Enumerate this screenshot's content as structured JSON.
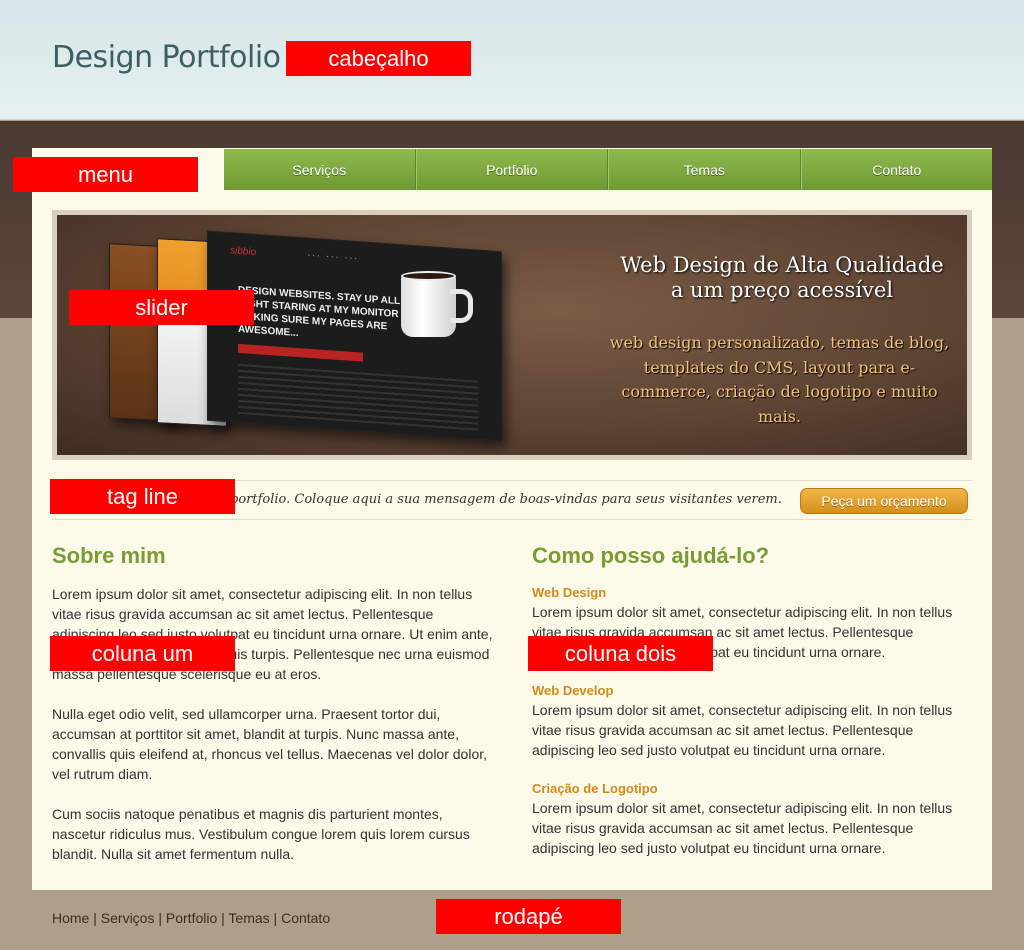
{
  "header": {
    "title": "Design Portfolio"
  },
  "annotations": {
    "header": "cabeçalho",
    "menu": "menu",
    "slider": "slider",
    "tagline": "tag line",
    "column_one": "coluna um",
    "column_two": "coluna dois",
    "footer": "rodapé"
  },
  "nav": {
    "items": [
      "Serviços",
      "Portfolio",
      "Temas",
      "Contato"
    ]
  },
  "slider": {
    "title_line1": "Web Design de Alta Qualidade",
    "title_line2": "a um preço acessível",
    "text": "web design personalizado, temas de blog, templates do CMS, layout para e-commerce, criação de logotipo e muito mais.",
    "mock_heading": "DESIGN WEBSITES. STAY UP ALL NIGHT STARING AT MY MONITOR MAKING SURE MY PAGES ARE AWESOME..."
  },
  "tagline": {
    "text": "portfolio. Coloque aqui a sua mensagem de boas-vindas para seus visitantes verem.",
    "button": "Peça um orçamento"
  },
  "column_one": {
    "heading": "Sobre mim",
    "paragraphs": [
      "Lorem ipsum dolor sit amet, consectetur adipiscing elit. In non tellus vitae risus gravida accumsan ac sit amet lectus. Pellentesque adipiscing leo sed justo volutpat eu tincidunt urna ornare. Ut enim ante, condimentum quis sodales quis turpis. Pellentesque nec urna euismod massa pellentesque scelerisque eu at eros.",
      "Nulla eget odio velit, sed ullamcorper urna. Praesent tortor dui, accumsan at porttitor sit amet, blandit at turpis. Nunc massa ante, convallis quis eleifend at, rhoncus vel tellus. Maecenas vel dolor dolor, vel rutrum diam.",
      "Cum sociis natoque penatibus et magnis dis parturient montes, nascetur ridiculus mus. Vestibulum congue lorem quis lorem cursus blandit. Nulla sit amet fermentum nulla."
    ]
  },
  "column_two": {
    "heading": "Como posso ajudá-lo?",
    "services": [
      {
        "title": "Web Design",
        "text": "Lorem ipsum dolor sit amet, consectetur adipiscing elit. In non tellus vitae risus gravida accumsan ac sit amet lectus. Pellentesque adipiscing leo sed justo volutpat eu tincidunt urna ornare."
      },
      {
        "title": "Web Develop",
        "text": "Lorem ipsum dolor sit amet, consectetur adipiscing elit. In non tellus vitae risus gravida accumsan ac sit amet lectus. Pellentesque adipiscing leo sed justo volutpat eu tincidunt urna ornare."
      },
      {
        "title": "Criação de Logotipo",
        "text": "Lorem ipsum dolor sit amet, consectetur adipiscing elit. In non tellus vitae risus gravida accumsan ac sit amet lectus. Pellentesque adipiscing leo sed justo volutpat eu tincidunt urna ornare."
      }
    ]
  },
  "footer": {
    "links": [
      "Home",
      "Serviços",
      "Portfolio",
      "Temas",
      "Contato"
    ],
    "separator": " | "
  }
}
